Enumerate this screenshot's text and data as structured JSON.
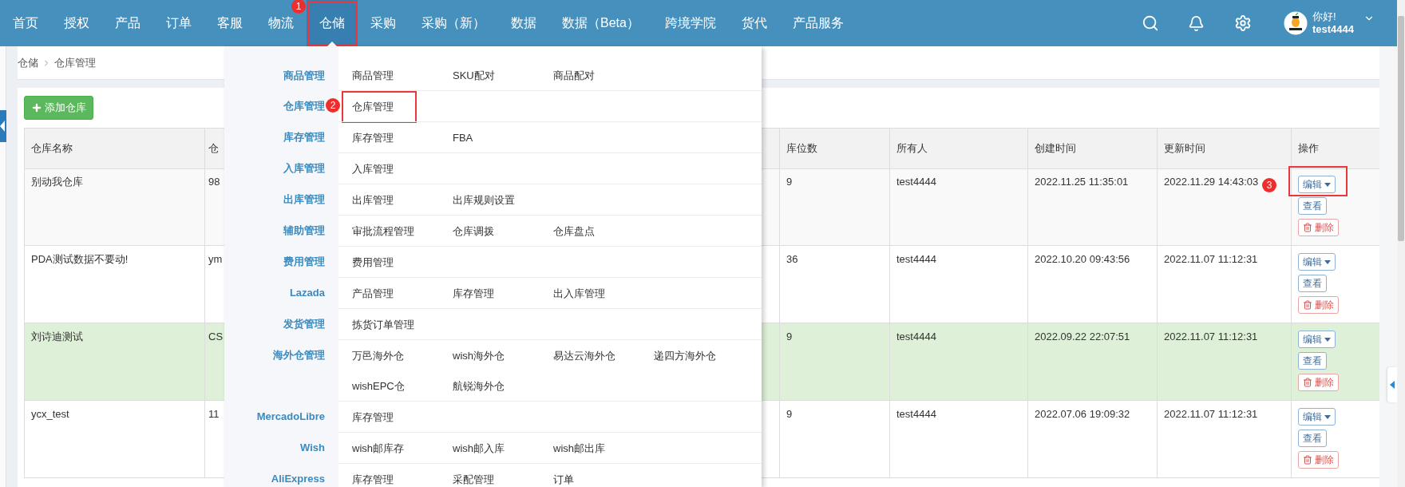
{
  "nav": {
    "items": [
      {
        "label": "首页",
        "selected": false
      },
      {
        "label": "授权",
        "selected": false
      },
      {
        "label": "产品",
        "selected": false
      },
      {
        "label": "订单",
        "selected": false
      },
      {
        "label": "客服",
        "selected": false
      },
      {
        "label": "物流",
        "selected": false
      },
      {
        "label": "仓储",
        "selected": true
      },
      {
        "label": "采购",
        "selected": false
      },
      {
        "label": "采购（新）",
        "selected": false
      },
      {
        "label": "数据",
        "selected": false
      },
      {
        "label": "数据（Beta）",
        "selected": false
      },
      {
        "label": "跨境学院",
        "selected": false
      },
      {
        "label": "货代",
        "selected": false
      },
      {
        "label": "产品服务",
        "selected": false
      }
    ]
  },
  "user": {
    "greeting": "你好!",
    "name": "test4444"
  },
  "breadcrumb": [
    "仓储",
    "仓库管理"
  ],
  "add_button": "添加仓库",
  "table": {
    "columns": [
      "仓库名称",
      "仓",
      "库位数",
      "所有人",
      "创建时间",
      "更新时间",
      "操作"
    ],
    "rows": [
      {
        "name": "别动我仓库",
        "column_2": "98",
        "slots": "9",
        "owner": "test4444",
        "created": "2022.11.25 11:35:01",
        "updated": "2022.11.29 14:43:03",
        "selected": false,
        "actions": [
          {
            "kind": "edit",
            "label": "编辑"
          },
          {
            "kind": "view",
            "label": "查看"
          },
          {
            "kind": "delete",
            "label": "删除"
          }
        ]
      },
      {
        "name": "PDA测试数据不要动!",
        "column_2": "ym",
        "slots": "36",
        "owner": "test4444",
        "created": "2022.10.20 09:43:56",
        "updated": "2022.11.07 11:12:31",
        "selected": false,
        "actions": [
          {
            "kind": "edit",
            "label": "编辑"
          },
          {
            "kind": "view",
            "label": "查看"
          },
          {
            "kind": "delete",
            "label": "删除"
          }
        ]
      },
      {
        "name": "刘诗迪测试",
        "column_2": "CS",
        "slots": "9",
        "owner": "test4444",
        "created": "2022.09.22 22:07:51",
        "updated": "2022.11.07 11:12:31",
        "selected": true,
        "actions": [
          {
            "kind": "edit",
            "label": "编辑"
          },
          {
            "kind": "view",
            "label": "查看"
          },
          {
            "kind": "delete",
            "label": "删除"
          }
        ]
      },
      {
        "name": "ycx_test",
        "column_2": "11",
        "slots": "9",
        "owner": "test4444",
        "created": "2022.07.06 19:09:32",
        "updated": "2022.11.07 11:12:31",
        "selected": false,
        "actions": [
          {
            "kind": "edit",
            "label": "编辑"
          },
          {
            "kind": "view",
            "label": "查看"
          },
          {
            "kind": "delete",
            "label": "删除"
          }
        ]
      }
    ]
  },
  "menu": {
    "groups": [
      {
        "label": "商品管理",
        "items": [
          "商品管理",
          "SKU配对",
          "商品配对"
        ]
      },
      {
        "label": "仓库管理",
        "items": [
          "仓库管理"
        ]
      },
      {
        "label": "库存管理",
        "items": [
          "库存管理",
          "FBA"
        ]
      },
      {
        "label": "入库管理",
        "items": [
          "入库管理"
        ]
      },
      {
        "label": "出库管理",
        "items": [
          "出库管理",
          "出库规则设置"
        ]
      },
      {
        "label": "辅助管理",
        "items": [
          "审批流程管理",
          "仓库调拨",
          "仓库盘点"
        ]
      },
      {
        "label": "费用管理",
        "items": [
          "费用管理"
        ]
      },
      {
        "label": "Lazada",
        "items": [
          "产品管理",
          "库存管理",
          "出入库管理"
        ]
      },
      {
        "label": "发货管理",
        "items": [
          "拣货订单管理"
        ]
      },
      {
        "label": "海外仓管理",
        "items": [
          "万邑海外仓",
          "wish海外仓",
          "易达云海外仓",
          "递四方海外仓",
          "wishEPC仓",
          "航锐海外仓"
        ]
      },
      {
        "label": "MercadoLibre",
        "items": [
          "库存管理"
        ]
      },
      {
        "label": "Wish",
        "items": [
          "wish邮库存",
          "wish邮入库",
          "wish邮出库"
        ]
      },
      {
        "label": "AliExpress",
        "items": [
          "库存管理",
          "采配管理",
          "订单"
        ]
      }
    ]
  },
  "annotations": [
    "1",
    "2",
    "3"
  ]
}
